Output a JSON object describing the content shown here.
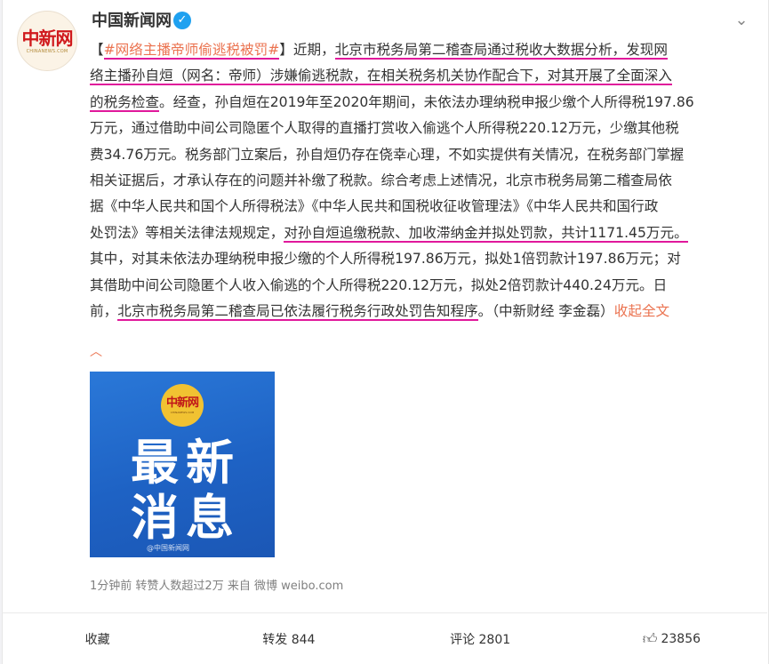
{
  "author": {
    "name": "中国新闻网",
    "avatar_logo_cn": "中新网",
    "avatar_logo_en": "CHINANEWS.COM",
    "verified_icon": "v-check"
  },
  "post": {
    "lines": [
      [
        {
          "t": "【",
          "c": ""
        },
        {
          "t": "#网络主播帝师偷逃税被罚#",
          "c": "topic ul"
        },
        {
          "t": "】近期，",
          "c": ""
        },
        {
          "t": "北京市税务局第二稽查局通过税收大数据分析，发现网",
          "c": "ul"
        }
      ],
      [
        {
          "t": "络主播孙自烜（网名：帝师）涉嫌偷逃税款，",
          "c": "ul"
        },
        {
          "t": "在相关税务机关协作配合下，对其开展了全面深入",
          "c": "ul"
        }
      ],
      [
        {
          "t": "的税务检查",
          "c": "ul"
        },
        {
          "t": "。经查，孙自烜在2019年至2020年期间，未依法办理纳税申报少缴个人所得税197.86",
          "c": ""
        }
      ],
      [
        {
          "t": "万元，通过借助中间公司隐匿个人取得的直播打赏收入偷逃个人所得税220.12万元，少缴其他税",
          "c": ""
        }
      ],
      [
        {
          "t": "费34.76万元。税务部门立案后，孙自烜仍存在侥幸心理，不如实提供有关情况，在税务部门掌握",
          "c": ""
        }
      ],
      [
        {
          "t": "相关证据后，才承认存在的问题并补缴了税款。综合考虑上述情况，北京市税务局第二稽查局依",
          "c": ""
        }
      ],
      [
        {
          "t": "据《中华人民共和国个人所得税法》《中华人民共和国税收征收管理法》《中华人民共和国行政",
          "c": ""
        }
      ],
      [
        {
          "t": "处罚法》等相关法律法规规定，",
          "c": ""
        },
        {
          "t": "对孙自烜追缴税款、加收滞纳金并拟处罚款，共计1171.45万元。",
          "c": "ul"
        }
      ],
      [
        {
          "t": "其中，对其未依法办理纳税申报少缴的个人所得税197.86万元，拟处1倍罚款计197.86万元；对",
          "c": ""
        }
      ],
      [
        {
          "t": "其借助中间公司隐匿个人收入偷逃的个人所得税220.12万元，拟处2倍罚款计440.24万元。日",
          "c": ""
        }
      ],
      [
        {
          "t": "前，",
          "c": ""
        },
        {
          "t": "北京市税务局第二稽查局已依法履行税务行政处罚告知程序",
          "c": "ul"
        },
        {
          "t": "。（中新财经 李金磊）",
          "c": ""
        },
        {
          "t": "收起全文",
          "c": "link"
        }
      ]
    ],
    "collapse_icon": "chevron-up-icon"
  },
  "media": {
    "badge_cn": "中新网",
    "badge_en": "CHINANEWS.COM",
    "headline_line1": "最新",
    "headline_line2": "消息",
    "watermark": "@中国新闻网"
  },
  "meta": {
    "time": "1分钟前",
    "reposts_note": "转赞人数超过2万",
    "source_prefix": "来自",
    "source": "微博 weibo.com"
  },
  "actions": {
    "favorite": "收藏",
    "repost": "转发 844",
    "comment": "评论 2801",
    "like_count": "23856"
  },
  "colors": {
    "link": "#eb7350",
    "underline_annotation": "#e0189b",
    "verified": "#1fa1f0",
    "media_bg": "#1e62c4"
  }
}
